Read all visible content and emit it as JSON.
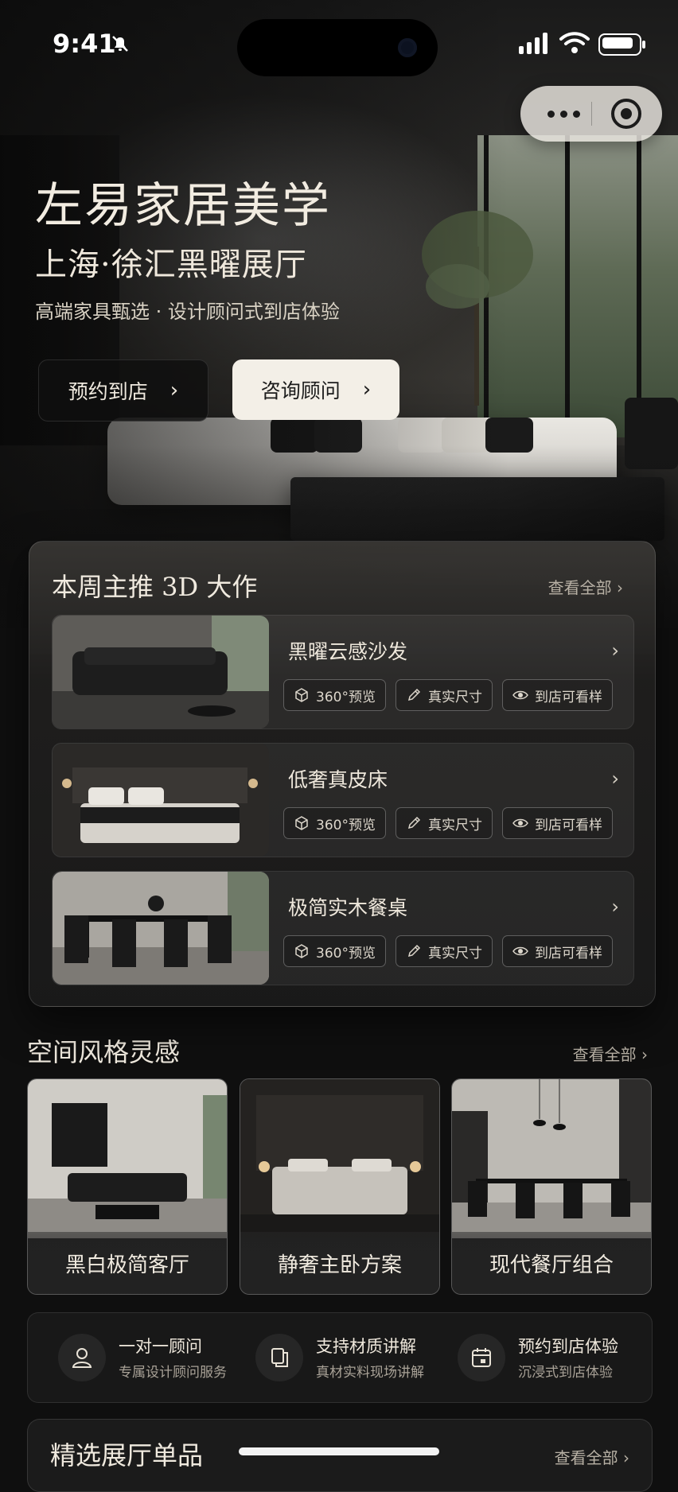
{
  "status_bar": {
    "time": "9:41"
  },
  "hero": {
    "title": "左易家居美学",
    "subtitle": "上海·徐汇黑曜展厅",
    "tagline": "高端家具甄选 · 设计顾问式到店体验",
    "buttons": [
      {
        "label": "预约到店",
        "style": "dark"
      },
      {
        "label": "咨询顾问",
        "style": "light"
      }
    ]
  },
  "featured": {
    "title": "本周主推 3D 大作",
    "see_all": "查看全部",
    "products": [
      {
        "name": "黑曜云感沙发",
        "thumb": "sofa"
      },
      {
        "name": "低奢真皮床",
        "thumb": "bed"
      },
      {
        "name": "极简实木餐桌",
        "thumb": "dining"
      }
    ],
    "chips": [
      {
        "label": "360°预览",
        "icon": "cube-icon"
      },
      {
        "label": "真实尺寸",
        "icon": "ruler-pencil-icon"
      },
      {
        "label": "到店可看样",
        "icon": "eye-icon"
      }
    ]
  },
  "styles": {
    "title": "空间风格灵感",
    "see_all": "查看全部",
    "cards": [
      {
        "label": "黑白极简客厅"
      },
      {
        "label": "静奢主卧方案"
      },
      {
        "label": "现代餐厅组合"
      }
    ]
  },
  "services": [
    {
      "title": "一对一顾问",
      "desc": "专属设计顾问服务",
      "icon": "user-icon"
    },
    {
      "title": "支持材质讲解",
      "desc": "真材实料现场讲解",
      "icon": "document-copy-icon"
    },
    {
      "title": "预约到店体验",
      "desc": "沉浸式到店体验",
      "icon": "calendar-icon"
    }
  ],
  "showroom": {
    "title": "精选展厅单品",
    "see_all": "查看全部"
  },
  "colors": {
    "background": "#0f0f0f",
    "text_primary": "#f0eadf",
    "text_muted": "#b8b1a5",
    "light_button": "#f3efe7"
  }
}
